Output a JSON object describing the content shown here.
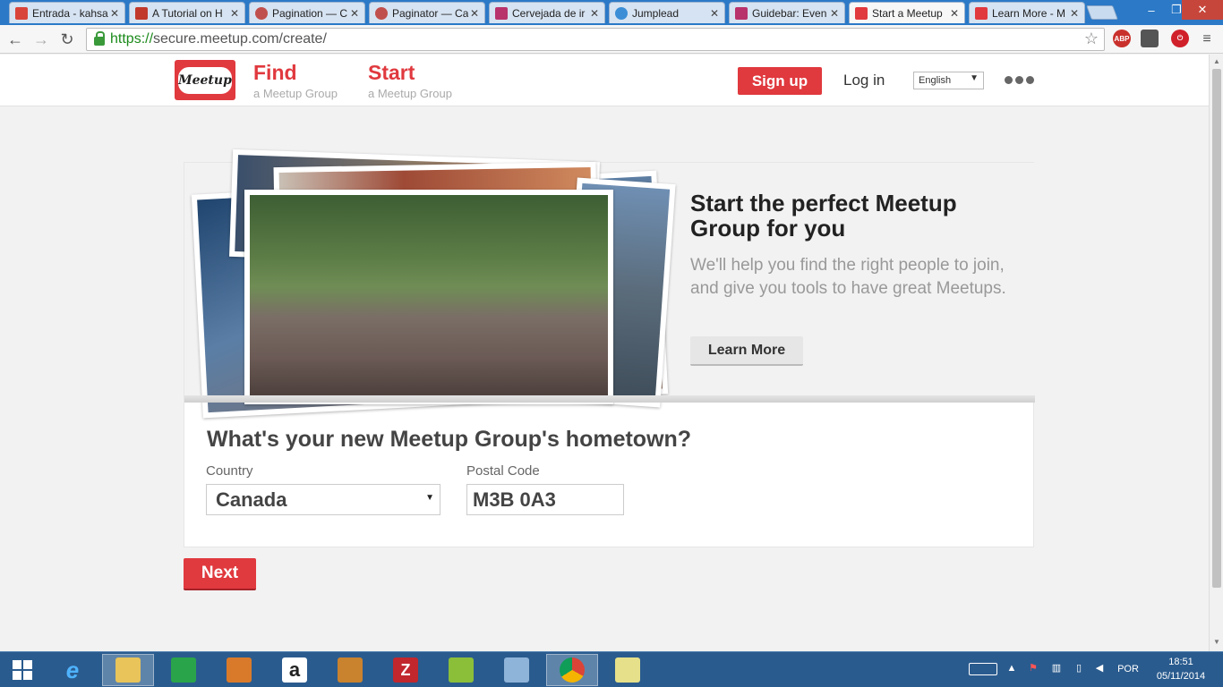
{
  "browser": {
    "tabs": [
      {
        "title": "Entrada - kahsa",
        "color": "#d9443a"
      },
      {
        "title": "A Tutorial on H",
        "color": "#c0392b"
      },
      {
        "title": "Pagination — C",
        "color": "#c0504d"
      },
      {
        "title": "Paginator — Ca",
        "color": "#c0504d"
      },
      {
        "title": "Cervejada de ir",
        "color": "#b8326b"
      },
      {
        "title": "Jumplead",
        "color": "#3b8ed6"
      },
      {
        "title": "Guidebar: Even",
        "color": "#b8326b"
      },
      {
        "title": "Start a Meetup",
        "color": "#e0393e"
      },
      {
        "title": "Learn More - M",
        "color": "#e0393e"
      }
    ],
    "url_scheme": "https://",
    "url_rest": "secure.meetup.com/create/",
    "abp_label": "ABP"
  },
  "header": {
    "logo_text": "Meetup",
    "find_label": "Find",
    "find_sub": "a Meetup Group",
    "start_label": "Start",
    "start_sub": "a Meetup Group",
    "signup_label": "Sign up",
    "login_label": "Log in",
    "language": "English"
  },
  "hero": {
    "title": "Start the perfect Meetup Group for you",
    "description": "We'll help you find the right people to join, and give you tools to have great Meetups.",
    "learn_more_label": "Learn More"
  },
  "form": {
    "question": "What's your new Meetup Group's hometown?",
    "country_label": "Country",
    "country_value": "Canada",
    "postal_label": "Postal Code",
    "postal_value": "M3B 0A3",
    "next_label": "Next"
  },
  "taskbar": {
    "language": "POR",
    "time": "18:51",
    "date": "05/11/2014"
  },
  "colors": {
    "brand": "#e0393e"
  }
}
